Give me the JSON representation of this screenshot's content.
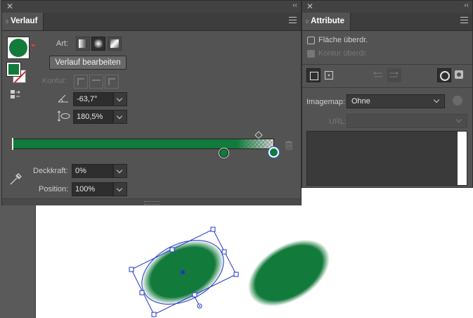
{
  "verlauf_panel": {
    "title": "Verlauf",
    "art_label": "Art:",
    "edit_button": "Verlauf bearbeiten",
    "kontur_label": "Kontur:",
    "angle_value": "-63,7°",
    "aspect_value": "180,5%",
    "opacity_label": "Deckkraft:",
    "opacity_value": "0%",
    "position_label": "Position:",
    "position_value": "100%",
    "gradient_color": "#127a3b"
  },
  "attribute_panel": {
    "title": "Attribute",
    "fill_overprint": "Fläche überdr.",
    "stroke_overprint": "Kontur überdr.",
    "imagemap_label": "Imagemap:",
    "imagemap_value": "Ohne",
    "url_label": "URL:",
    "url_value": ""
  },
  "colors": {
    "panel_bg": "#535353",
    "shape_fill": "#127a3b",
    "selection": "#2233cc"
  }
}
